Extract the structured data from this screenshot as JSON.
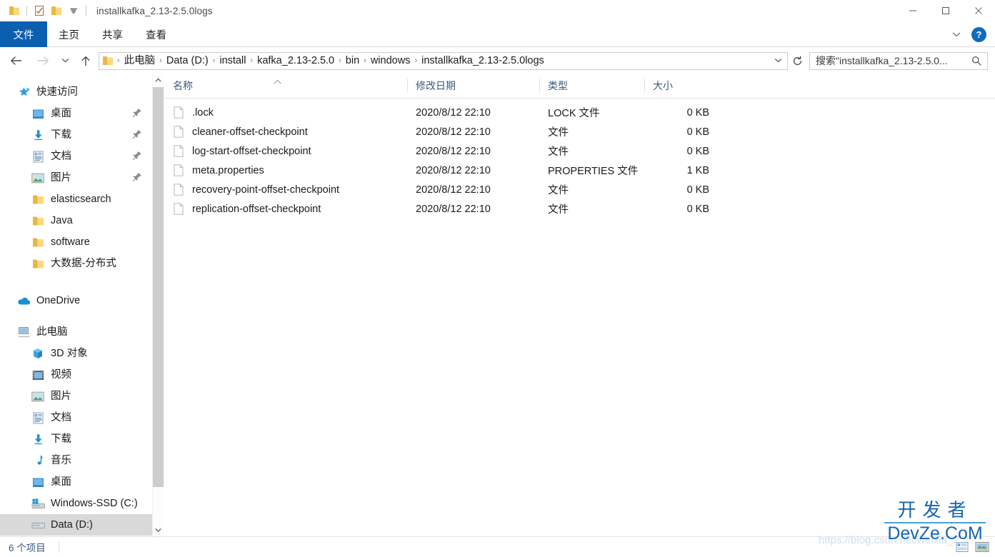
{
  "window": {
    "title": "installkafka_2.13-2.5.0logs",
    "controls": {
      "minimize": "—",
      "maximize": "□",
      "close": "✕"
    },
    "quick_access_toolbar": [
      {
        "name": "folder-icon",
        "label": ""
      },
      {
        "name": "properties-icon",
        "label": ""
      },
      {
        "name": "new-folder-icon",
        "label": ""
      },
      {
        "name": "customize-dropdown-icon",
        "label": ""
      }
    ]
  },
  "ribbon": {
    "tabs": [
      {
        "label": "文件",
        "active": true
      },
      {
        "label": "主页",
        "active": false
      },
      {
        "label": "共享",
        "active": false
      },
      {
        "label": "查看",
        "active": false
      }
    ],
    "expand_label": "",
    "help_label": "?"
  },
  "nav_toolbar": {
    "back_label": "",
    "forward_label": "",
    "recent_label": "",
    "up_label": "",
    "refresh_label": ""
  },
  "address": {
    "crumbs": [
      "此电脑",
      "Data (D:)",
      "install",
      "kafka_2.13-2.5.0",
      "bin",
      "windows",
      "installkafka_2.13-2.5.0logs"
    ],
    "separator": "›"
  },
  "search": {
    "placeholder": "搜索\"installkafka_2.13-2.5.0...",
    "icon": "search-icon"
  },
  "sidebar": {
    "groups": [
      {
        "name": "快速访问",
        "icon": "star-icon",
        "items": [
          {
            "label": "桌面",
            "icon": "desktop-icon",
            "pinned": true
          },
          {
            "label": "下载",
            "icon": "download-icon",
            "pinned": true
          },
          {
            "label": "文档",
            "icon": "document-icon",
            "pinned": true
          },
          {
            "label": "图片",
            "icon": "pictures-icon",
            "pinned": true
          },
          {
            "label": "elasticsearch",
            "icon": "folder-icon",
            "pinned": false
          },
          {
            "label": "Java",
            "icon": "folder-icon",
            "pinned": false
          },
          {
            "label": "software",
            "icon": "folder-icon",
            "pinned": false
          },
          {
            "label": "大数据-分布式",
            "icon": "folder-icon",
            "pinned": false
          }
        ]
      },
      {
        "name": "OneDrive",
        "icon": "cloud-icon",
        "items": []
      },
      {
        "name": "此电脑",
        "icon": "computer-icon",
        "items": [
          {
            "label": "3D 对象",
            "icon": "3d-object-icon",
            "pinned": false
          },
          {
            "label": "视频",
            "icon": "video-icon",
            "pinned": false
          },
          {
            "label": "图片",
            "icon": "pictures-icon",
            "pinned": false
          },
          {
            "label": "文档",
            "icon": "document-icon",
            "pinned": false
          },
          {
            "label": "下载",
            "icon": "download-icon",
            "pinned": false
          },
          {
            "label": "音乐",
            "icon": "music-icon",
            "pinned": false
          },
          {
            "label": "桌面",
            "icon": "desktop-icon",
            "pinned": false
          },
          {
            "label": "Windows-SSD (C:)",
            "icon": "system-drive-icon",
            "pinned": false
          },
          {
            "label": "Data (D:)",
            "icon": "drive-icon",
            "pinned": false,
            "selected": true
          }
        ]
      }
    ]
  },
  "file_list": {
    "columns": [
      {
        "key": "name",
        "label": "名称",
        "sorted": "asc"
      },
      {
        "key": "date",
        "label": "修改日期",
        "sorted": ""
      },
      {
        "key": "type",
        "label": "类型",
        "sorted": ""
      },
      {
        "key": "size",
        "label": "大小",
        "sorted": ""
      }
    ],
    "rows": [
      {
        "name": ".lock",
        "date": "2020/8/12 22:10",
        "type": "LOCK 文件",
        "size": "0 KB",
        "icon": "file-icon"
      },
      {
        "name": "cleaner-offset-checkpoint",
        "date": "2020/8/12 22:10",
        "type": "文件",
        "size": "0 KB",
        "icon": "file-icon"
      },
      {
        "name": "log-start-offset-checkpoint",
        "date": "2020/8/12 22:10",
        "type": "文件",
        "size": "0 KB",
        "icon": "file-icon"
      },
      {
        "name": "meta.properties",
        "date": "2020/8/12 22:10",
        "type": "PROPERTIES 文件",
        "size": "1 KB",
        "icon": "file-icon"
      },
      {
        "name": "recovery-point-offset-checkpoint",
        "date": "2020/8/12 22:10",
        "type": "文件",
        "size": "0 KB",
        "icon": "file-icon"
      },
      {
        "name": "replication-offset-checkpoint",
        "date": "2020/8/12 22:10",
        "type": "文件",
        "size": "0 KB",
        "icon": "file-icon"
      }
    ]
  },
  "statusbar": {
    "item_count": "6 个项目",
    "view_details_label": "",
    "view_large_icons_label": ""
  },
  "watermark": {
    "url": "https://blog.csdn.net/weixin_2...",
    "brand_cn": "开发者",
    "brand_en": "DevZe.CoM"
  },
  "colors": {
    "accent": "#0c5faf",
    "header_text": "#3b5a7d",
    "selection": "#d9d9d9",
    "watermark": "#1565b0"
  }
}
